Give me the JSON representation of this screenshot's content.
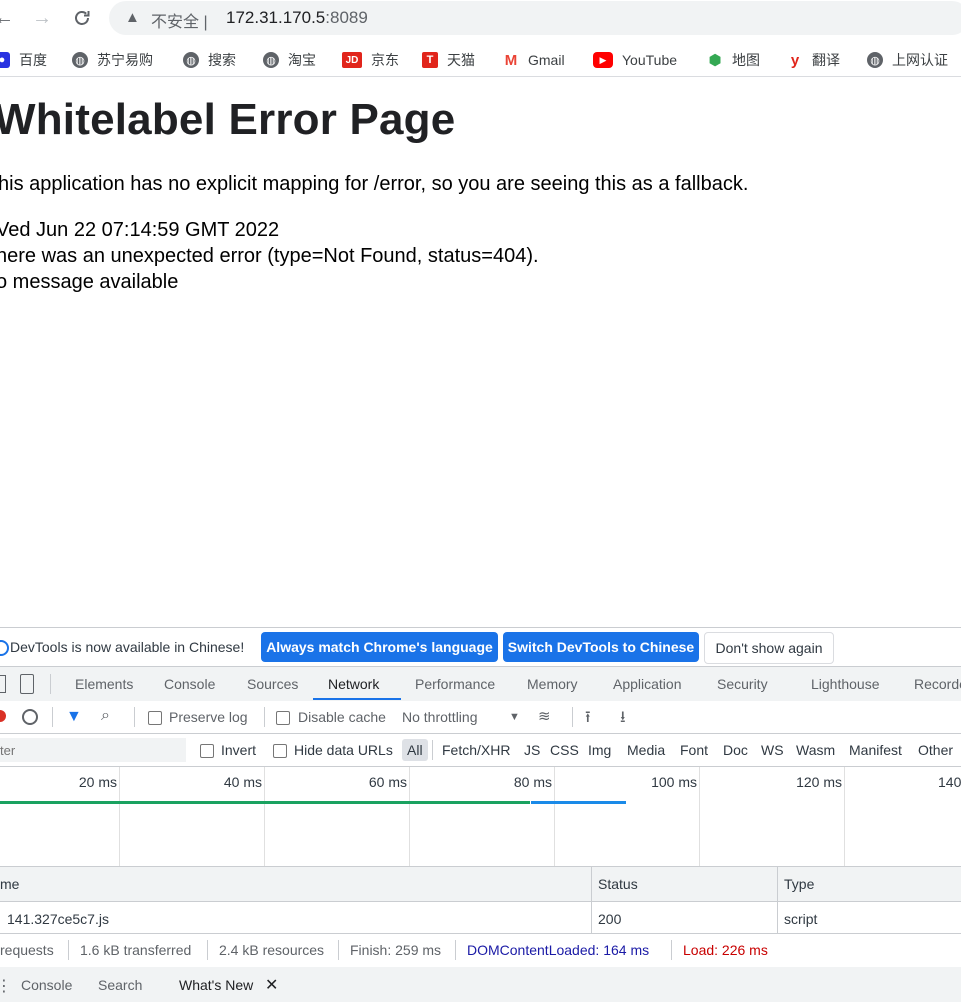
{
  "browser": {
    "insecure_label": "不安全",
    "url_host": "172.31.170.5",
    "url_port": ":8089"
  },
  "bookmarks": [
    {
      "label": "百度",
      "icon": "baidu-icon",
      "color": "#2932e1"
    },
    {
      "label": "苏宁易购",
      "icon": "globe-icon",
      "color": "#5f6368"
    },
    {
      "label": "搜索",
      "icon": "globe-icon",
      "color": "#5f6368"
    },
    {
      "label": "淘宝",
      "icon": "globe-icon",
      "color": "#5f6368"
    },
    {
      "label": "京东",
      "icon": "jd-icon",
      "color": "#e1251b"
    },
    {
      "label": "天猫",
      "icon": "tmall-icon",
      "color": "#e1251b"
    },
    {
      "label": "Gmail",
      "icon": "gmail-icon",
      "color": "#ea4335"
    },
    {
      "label": "YouTube",
      "icon": "youtube-icon",
      "color": "#ff0000"
    },
    {
      "label": "地图",
      "icon": "maps-pin-icon",
      "color": "#34a853"
    },
    {
      "label": "翻译",
      "icon": "translate-icon",
      "color": "#e1251b"
    },
    {
      "label": "上网认证",
      "icon": "globe-icon",
      "color": "#5f6368"
    }
  ],
  "page": {
    "title": "Whitelabel Error Page",
    "intro": "his application has no explicit mapping for /error, so you are seeing this as a fallback.",
    "date": "Ved Jun 22 07:14:59 GMT 2022",
    "error": "here was an unexpected error (type=Not Found, status=404).",
    "message": "o message available"
  },
  "devtools": {
    "infobar": {
      "text": "DevTools is now available in Chinese!",
      "btn_match": "Always match Chrome's language",
      "btn_switch": "Switch DevTools to Chinese",
      "btn_dismiss": "Don't show again"
    },
    "tabs": [
      "Elements",
      "Console",
      "Sources",
      "Network",
      "Performance",
      "Memory",
      "Application",
      "Security",
      "Lighthouse",
      "Recorde"
    ],
    "active_tab": "Network",
    "toolbar": {
      "preserve_log": "Preserve log",
      "disable_cache": "Disable cache",
      "throttling": "No throttling"
    },
    "filter": {
      "placeholder": "ter",
      "invert": "Invert",
      "hide_data_urls": "Hide data URLs",
      "types": [
        "All",
        "Fetch/XHR",
        "JS",
        "CSS",
        "Img",
        "Media",
        "Font",
        "Doc",
        "WS",
        "Wasm",
        "Manifest",
        "Other"
      ]
    },
    "timeline_ticks": [
      "20 ms",
      "40 ms",
      "60 ms",
      "80 ms",
      "100 ms",
      "120 ms",
      "140"
    ],
    "table": {
      "headers": {
        "name": "me",
        "status": "Status",
        "type": "Type"
      },
      "rows": [
        {
          "name": "141.327ce5c7.js",
          "status": "200",
          "type": "script"
        }
      ]
    },
    "status_bar": {
      "requests": "requests",
      "transferred": "1.6 kB transferred",
      "resources": "2.4 kB resources",
      "finish": "Finish: 259 ms",
      "dcl": "DOMContentLoaded: 164 ms",
      "load": "Load: 226 ms",
      "dcl_color": "#1a1aa6",
      "load_color": "#c80000"
    },
    "drawer_tabs": {
      "console": "Console",
      "search": "Search",
      "whats_new": "What's New"
    }
  }
}
